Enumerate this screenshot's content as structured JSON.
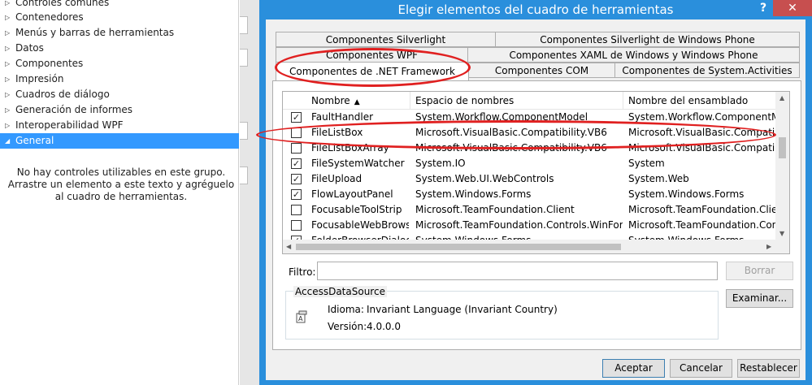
{
  "toolbox": {
    "items": [
      {
        "label": "Controles comunes",
        "expanded": false
      },
      {
        "label": "Contenedores",
        "expanded": false
      },
      {
        "label": "Menús y barras de herramientas",
        "expanded": false
      },
      {
        "label": "Datos",
        "expanded": false
      },
      {
        "label": "Componentes",
        "expanded": false
      },
      {
        "label": "Impresión",
        "expanded": false
      },
      {
        "label": "Cuadros de diálogo",
        "expanded": false
      },
      {
        "label": "Generación de informes",
        "expanded": false
      },
      {
        "label": "Interoperabilidad WPF",
        "expanded": false
      },
      {
        "label": "General",
        "expanded": true,
        "selected": true
      }
    ],
    "empty_message": "No hay controles utilizables en este grupo. Arrastre un elemento a este texto y agréguelo al cuadro de herramientas.",
    "arrow_collapsed": "▷",
    "arrow_expanded": "◢"
  },
  "dialog": {
    "title": "Elegir elementos del cuadro de herramientas",
    "help_glyph": "?",
    "close_glyph": "✕",
    "tabs": [
      "Componentes Silverlight",
      "Componentes Silverlight de Windows Phone",
      "Componentes WPF",
      "Componentes XAML de Windows y Windows Phone",
      "Componentes de .NET Framework",
      "Componentes COM",
      "Componentes de System.Activities"
    ],
    "active_tab": "Componentes de .NET Framework",
    "list": {
      "columns": [
        "Nombre",
        "Espacio de nombres",
        "Nombre del ensamblado"
      ],
      "sort_glyph": "▲",
      "rows": [
        {
          "checked": true,
          "name": "FaultHandler",
          "namespace": "System.Workflow.ComponentModel",
          "assembly": "System.Workflow.ComponentModel"
        },
        {
          "checked": false,
          "name": "FileListBox",
          "namespace": "Microsoft.VisualBasic.Compatibility.VB6",
          "assembly": "Microsoft.VisualBasic.Compatibility"
        },
        {
          "checked": false,
          "name": "FileListBoxArray",
          "namespace": "Microsoft.VisualBasic.Compatibility.VB6",
          "assembly": "Microsoft.VisualBasic.Compatibility"
        },
        {
          "checked": true,
          "name": "FileSystemWatcher",
          "namespace": "System.IO",
          "assembly": "System"
        },
        {
          "checked": true,
          "name": "FileUpload",
          "namespace": "System.Web.UI.WebControls",
          "assembly": "System.Web"
        },
        {
          "checked": true,
          "name": "FlowLayoutPanel",
          "namespace": "System.Windows.Forms",
          "assembly": "System.Windows.Forms"
        },
        {
          "checked": false,
          "name": "FocusableToolStrip",
          "namespace": "Microsoft.TeamFoundation.Client",
          "assembly": "Microsoft.TeamFoundation.Client"
        },
        {
          "checked": false,
          "name": "FocusableWebBrowse",
          "namespace": "Microsoft.TeamFoundation.Controls.WinForms",
          "assembly": "Microsoft.TeamFoundation.Controls"
        },
        {
          "checked": true,
          "name": "FolderBrowserDialog",
          "namespace": "System.Windows.Forms",
          "assembly": "System.Windows.Forms"
        }
      ]
    },
    "filter": {
      "label": "Filtro:",
      "value": "",
      "clear_label": "Borrar"
    },
    "browse_label": "Examinar...",
    "info": {
      "title": "AccessDataSource",
      "language_label": "Idioma:",
      "language_value": "Invariant Language (Invariant Country)",
      "version_label": "Versión:",
      "version_value": "4.0.0.0"
    },
    "buttons": {
      "ok": "Aceptar",
      "cancel": "Cancelar",
      "reset": "Restablecer"
    }
  },
  "colors": {
    "titlebar": "#2a8fdc",
    "close": "#c74f4f",
    "selection": "#3399ff",
    "annotation": "#e02020"
  }
}
